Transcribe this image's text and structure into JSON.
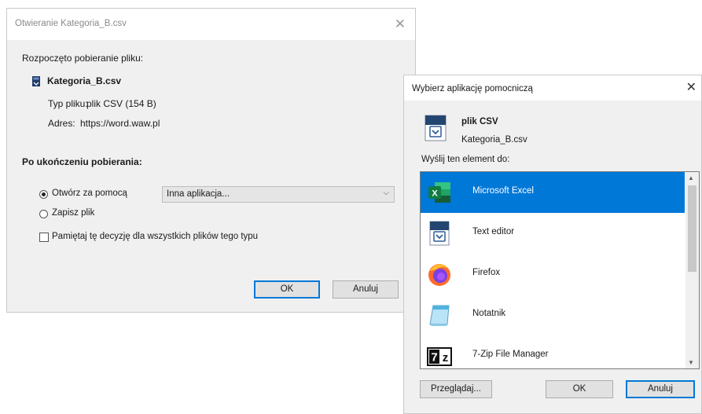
{
  "download_dialog": {
    "title": "Otwieranie Kategoria_B.csv",
    "started_label": "Rozpoczęto pobieranie pliku:",
    "file_name": "Kategoria_B.csv",
    "file_type_label": "Typ pliku:",
    "file_type_value": "plik CSV (154 B)",
    "address_label": "Adres:",
    "address_value": "https://word.waw.pl",
    "after_download_heading": "Po ukończeniu pobierania:",
    "open_with_label": "Otwórz za pomocą",
    "open_with_selected": "Inna aplikacja...",
    "save_file_label": "Zapisz plik",
    "remember_label": "Pamiętaj tę decyzję dla wszystkich plików tego typu",
    "ok_label": "OK",
    "cancel_label": "Anuluj"
  },
  "helper_dialog": {
    "title": "Wybierz aplikację pomocniczą",
    "file_kind": "plik CSV",
    "file_name": "Kategoria_B.csv",
    "send_to_label": "Wyślij ten element do:",
    "apps": [
      {
        "label": "Microsoft Excel",
        "icon": "excel-icon",
        "selected": true
      },
      {
        "label": "Text editor",
        "icon": "text-editor-icon",
        "selected": false
      },
      {
        "label": "Firefox",
        "icon": "firefox-icon",
        "selected": false
      },
      {
        "label": "Notatnik",
        "icon": "notepad-icon",
        "selected": false
      },
      {
        "label": "7-Zip File Manager",
        "icon": "7zip-icon",
        "selected": false
      }
    ],
    "browse_label": "Przeglądaj...",
    "ok_label": "OK",
    "cancel_label": "Anuluj"
  },
  "colors": {
    "selection": "#0078d7",
    "dialog_bg": "#f0f0f0",
    "excel_green": "#107c41"
  }
}
